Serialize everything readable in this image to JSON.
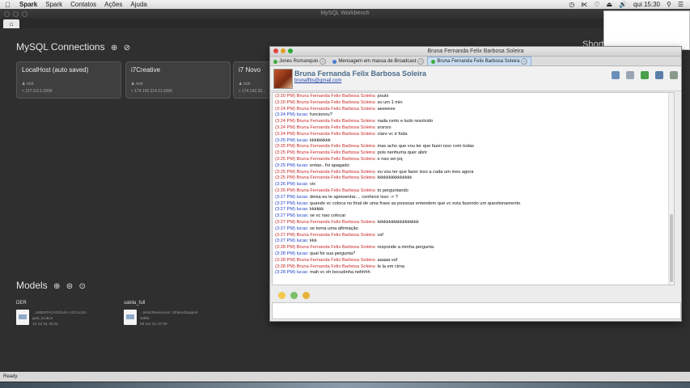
{
  "menubar": {
    "apple_icon": "apple-icon",
    "app_name": "Spark",
    "items": [
      "Spark",
      "Contatos",
      "Ações",
      "Ajuda"
    ],
    "clock": "qui 15:30"
  },
  "workbench": {
    "title": "MySQL Workbench",
    "home_tab_icon": "home-icon",
    "connections_title": "MySQL Connections",
    "connections": [
      {
        "name": "LocalHost (auto saved)",
        "user": "root",
        "host": "127.0.0.1:3306"
      },
      {
        "name": "i7Creative",
        "user": "root",
        "host": "174.142.214.11:3306"
      },
      {
        "name": "i7 Novo",
        "user": "root",
        "host": "174.142.20..."
      }
    ],
    "shortcuts_title": "Short",
    "models_title": "Models",
    "models": [
      {
        "name": "DER",
        "path": "...UMENTAÇÃO/GUIA LOCALIZA",
        "schema": "guia_locaiza",
        "date": "15 Jul 15, 09:31"
      },
      {
        "name": "sakila_full",
        "path": "...tents/Resources/../SharedSupport",
        "schema": "sakila",
        "date": "08 Jun 15, 07:39"
      }
    ],
    "status": "Ready."
  },
  "spark": {
    "title": "Bruna Fernanda Felix Barbosa Soleira",
    "tabs": [
      {
        "label": "Jones Romanquio",
        "active": false,
        "color": "#3cae3c"
      },
      {
        "label": "Mensagem em massa de Broadcast",
        "active": false,
        "color": "#4a7fd0"
      },
      {
        "label": "Bruna Fernanda Felix Barbosa Soleira",
        "active": true,
        "color": "#3cae3c"
      }
    ],
    "contact_name": "Bruna Fernanda Felix Barbosa Soleira",
    "contact_email": "brunaffbs@gmail.com",
    "messages": [
      {
        "time": "(3:20 PM)",
        "from": "Bruna Fernanda Felix Barbosa Soleira",
        "who": "them",
        "text": "pouts"
      },
      {
        "time": "(3:20 PM)",
        "from": "Bruna Fernanda Felix Barbosa Soleira",
        "who": "them",
        "text": "so um 1 min"
      },
      {
        "time": "(3:24 PM)",
        "from": "Bruna Fernanda Felix Barbosa Soleira",
        "who": "them",
        "text": "aeeeeee"
      },
      {
        "time": "(3:24 PM)",
        "from": "lucas",
        "who": "me",
        "text": "funcionou?"
      },
      {
        "time": "(3:24 PM)",
        "from": "Bruna Fernanda Felix Barbosa Soleira",
        "who": "them",
        "text": "nada certo e tudo resolvido"
      },
      {
        "time": "(3:24 PM)",
        "from": "Bruna Fernanda Felix Barbosa Soleira",
        "who": "them",
        "text": "srsrsrs"
      },
      {
        "time": "(3:24 PM)",
        "from": "Bruna Fernanda Felix Barbosa Soleira",
        "who": "them",
        "text": "claro vc é foda"
      },
      {
        "time": "(3:25 PM)",
        "from": "lucas",
        "who": "me",
        "text": "kkkkkkkkk"
      },
      {
        "time": "(3:25 PM)",
        "from": "Bruna Fernanda Felix Barbosa Soleira",
        "who": "them",
        "text": "mas acho que vou ter que fazer isso com todas"
      },
      {
        "time": "(3:25 PM)",
        "from": "Bruna Fernanda Felix Barbosa Soleira",
        "who": "them",
        "text": "pois nenhuma quer abrir"
      },
      {
        "time": "(3:25 PM)",
        "from": "Bruna Fernanda Felix Barbosa Soleira",
        "who": "them",
        "text": "e nao sei pq"
      },
      {
        "time": "(3:25 PM)",
        "from": "lucas",
        "who": "me",
        "text": "entao.. foi apagado"
      },
      {
        "time": "(3:25 PM)",
        "from": "Bruna Fernanda Felix Barbosa Soleira",
        "who": "them",
        "text": "eu vou ter que fazer isso a cada um mes agora"
      },
      {
        "time": "(3:25 PM)",
        "from": "Bruna Fernanda Felix Barbosa Soleira",
        "who": "them",
        "text": "kkkkkkkkkkkkkkk"
      },
      {
        "time": "(3:26 PM)",
        "from": "lucas",
        "who": "me",
        "text": "vix"
      },
      {
        "time": "(3:26 PM)",
        "from": "Bruna Fernanda Felix Barbosa Soleira",
        "who": "them",
        "text": "to perguntando"
      },
      {
        "time": "(3:27 PM)",
        "from": "lucas",
        "who": "me",
        "text": "deixa eu te apresentar.... conhece isso -> ?"
      },
      {
        "time": "(3:27 PM)",
        "from": "lucas",
        "who": "me",
        "text": "quando vc coloca no final de uma frase as pessoas entendem que vc esta fazendo um questionamento"
      },
      {
        "time": "(3:27 PM)",
        "from": "lucas",
        "who": "me",
        "text": "kkkkkk"
      },
      {
        "time": "(3:27 PM)",
        "from": "lucas",
        "who": "me",
        "text": "se vc nao colocar"
      },
      {
        "time": "(3:27 PM)",
        "from": "Bruna Fernanda Felix Barbosa Soleira",
        "who": "them",
        "text": "kkkkkkkkkkkkkkkkkk"
      },
      {
        "time": "(3:27 PM)",
        "from": "lucas",
        "who": "me",
        "text": "se torna uma afirmação"
      },
      {
        "time": "(3:27 PM)",
        "from": "Bruna Fernanda Felix Barbosa Soleira",
        "who": "them",
        "text": "vsf"
      },
      {
        "time": "(3:27 PM)",
        "from": "lucas",
        "who": "me",
        "text": "kkk"
      },
      {
        "time": "(3:28 PM)",
        "from": "Bruna Fernanda Felix Barbosa Soleira",
        "who": "them",
        "text": "responde a minha pergunta"
      },
      {
        "time": "(3:28 PM)",
        "from": "lucas",
        "who": "me",
        "text": "qual foi sua pergunta?"
      },
      {
        "time": "(3:28 PM)",
        "from": "Bruna Fernanda Felix Barbosa Soleira",
        "who": "them",
        "text": "aaaaa vsf"
      },
      {
        "time": "(3:28 PM)",
        "from": "Bruna Fernanda Felix Barbosa Soleira",
        "who": "them",
        "text": "le la em cima"
      },
      {
        "time": "(3:28 PM)",
        "from": "lucas",
        "who": "me",
        "text": "mah vc eh bocudinha nehhhh"
      }
    ],
    "compose_value": ""
  }
}
